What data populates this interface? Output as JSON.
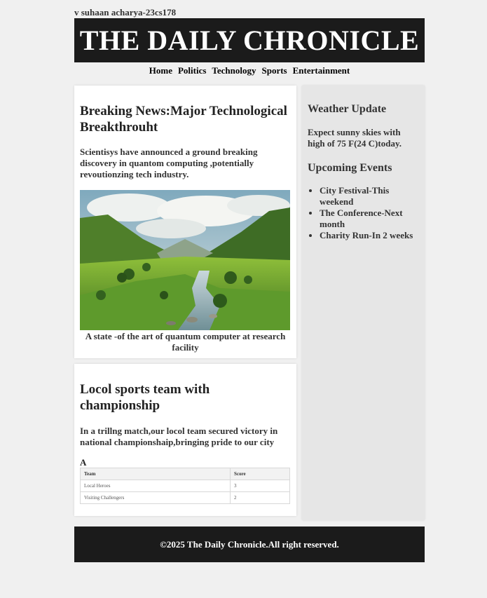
{
  "author_line": "v suhaan acharya-23cs178",
  "masthead": {
    "title": "THE DAILY CHRONICLE"
  },
  "nav": {
    "items": [
      "Home",
      "Politics",
      "Technology",
      "Sports",
      "Entertainment"
    ]
  },
  "article1": {
    "headline": "Breaking News:Major Technological Breakthrouht",
    "lead": "Scientisys have announced a ground breaking discovery in quantom computing ,potentially revoutionzing tech industry.",
    "caption": "A state -of the art of quantum computer at research facility"
  },
  "article2": {
    "headline": "Locol sports team with championship",
    "lead": "In a trillng match,our locol team secured victory in national championshaip,bringing pride to our city",
    "table_caption": "A",
    "table": {
      "headers": [
        "Team",
        "Score"
      ],
      "rows": [
        [
          "Local Heroes",
          "3"
        ],
        [
          "Visiting Challengers",
          "2"
        ]
      ]
    }
  },
  "sidebar": {
    "weather_heading": "Weather Update",
    "weather_text": "Expect sunny skies with high of 75 F(24 C)today.",
    "events_heading": "Upcoming Events",
    "events": [
      "City Festival-This weekend",
      "The Conference-Next month",
      "Charity Run-In 2 weeks"
    ]
  },
  "footer": {
    "text": "©2025 The Daily Chronicle.All right reserved."
  },
  "colors": {
    "masthead_bg": "#1b1b1b",
    "sidebar_bg": "#e6e6e6",
    "page_bg": "#f0f0f0"
  }
}
